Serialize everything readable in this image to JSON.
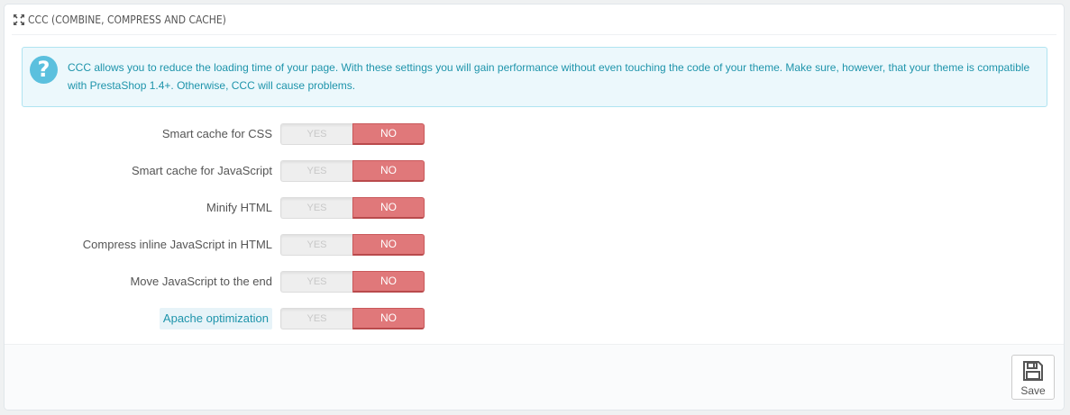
{
  "panel": {
    "title": "CCC (COMBINE, COMPRESS AND CACHE)",
    "title_icon": "arrows-expand-icon"
  },
  "alert": {
    "icon": "question-icon",
    "icon_glyph": "?",
    "text": "CCC allows you to reduce the loading time of your page. With these settings you will gain performance without even touching the code of your theme. Make sure, however, that your theme is compatible with PrestaShop 1.4+. Otherwise, CCC will cause problems."
  },
  "settings": [
    {
      "label": "Smart cache for CSS",
      "yes": "YES",
      "no": "NO",
      "value": "NO"
    },
    {
      "label": "Smart cache for JavaScript",
      "yes": "YES",
      "no": "NO",
      "value": "NO"
    },
    {
      "label": "Minify HTML",
      "yes": "YES",
      "no": "NO",
      "value": "NO"
    },
    {
      "label": "Compress inline JavaScript in HTML",
      "yes": "YES",
      "no": "NO",
      "value": "NO"
    },
    {
      "label": "Move JavaScript to the end",
      "yes": "YES",
      "no": "NO",
      "value": "NO"
    },
    {
      "label": "Apache optimization",
      "yes": "YES",
      "no": "NO",
      "value": "NO",
      "highlighted": true
    }
  ],
  "footer": {
    "save_label": "Save",
    "save_icon": "floppy-disk-icon"
  },
  "colors": {
    "no_active": "#e0787a",
    "alert_text": "#1e94ab",
    "alert_bg": "#ecf8fc"
  }
}
